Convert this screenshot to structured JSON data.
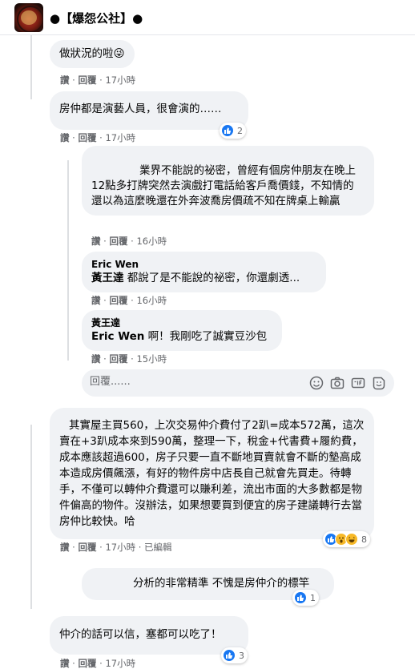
{
  "group": {
    "name": "●【爆怨公社】●"
  },
  "comments": [
    {
      "text": "做狀況的啦😜",
      "actions": {
        "like": "讚",
        "reply": "回覆",
        "time": "17小時"
      }
    },
    {
      "text": "房仲都是演藝人員，很會演的……",
      "actions": {
        "like": "讚",
        "reply": "回覆",
        "time": "17小時"
      },
      "reaction_count": "2"
    },
    {
      "text": "業界不能說的祕密，曾經有個房仲朋友在晚上12點多打牌突然去演戲打電話給客戶喬價錢，不知情的還以為這麼晚還在外奔波喬房價疏不知在牌桌上輸贏",
      "actions": {
        "like": "讚",
        "reply": "回覆",
        "time": "16小時"
      }
    },
    {
      "author": "Eric Wen",
      "tag": "黃王達",
      "text": " 都說了是不能說的祕密，你還劇透...",
      "actions": {
        "like": "讚",
        "reply": "回覆",
        "time": "16小時"
      }
    },
    {
      "author": "黃王達",
      "tag": "Eric Wen",
      "text": " 啊！我剛吃了誠實豆沙包",
      "actions": {
        "like": "讚",
        "reply": "回覆",
        "time": "15小時"
      }
    },
    {
      "text": "其實屋主買560，上次交易仲介費付了2趴=成本572萬，這次賣在+3趴成本來到590萬，整理一下，稅金+代書費+履約費，成本應該超過600，房子只要一直不斷地買賣就會不斷的墊高成本造成房價飆漲，有好的物件房中店長自己就會先買走。待轉手，不僅可以轉仲介費還可以賺利差，流出市面的大多數都是物件偏高的物件。沒辦法，如果想要買到便宜的房子建議轉行去當房仲比較快。哈",
      "actions": {
        "like": "讚",
        "reply": "回覆",
        "time": "17小時",
        "edited": "已編輯"
      },
      "reaction_count": "8"
    },
    {
      "text": "分析的非常精準 不愧是房仲介的標竿",
      "reaction_count": "1"
    },
    {
      "text": "仲介的話可以信，塞都可以吃了！",
      "actions": {
        "like": "讚",
        "reply": "回覆",
        "time": "17小時"
      },
      "reaction_count": "3"
    }
  ],
  "reply_box": {
    "placeholder": "回覆......"
  },
  "icons": {
    "like": "like-icon",
    "haha": "haha-icon",
    "wow": "wow-icon",
    "emoji": "emoji-icon",
    "camera": "camera-icon",
    "gif": "gif-icon",
    "sticker": "sticker-icon"
  },
  "colors": {
    "like": "#1877f2",
    "bubble": "#f0f2f5",
    "meta": "#65676b"
  }
}
